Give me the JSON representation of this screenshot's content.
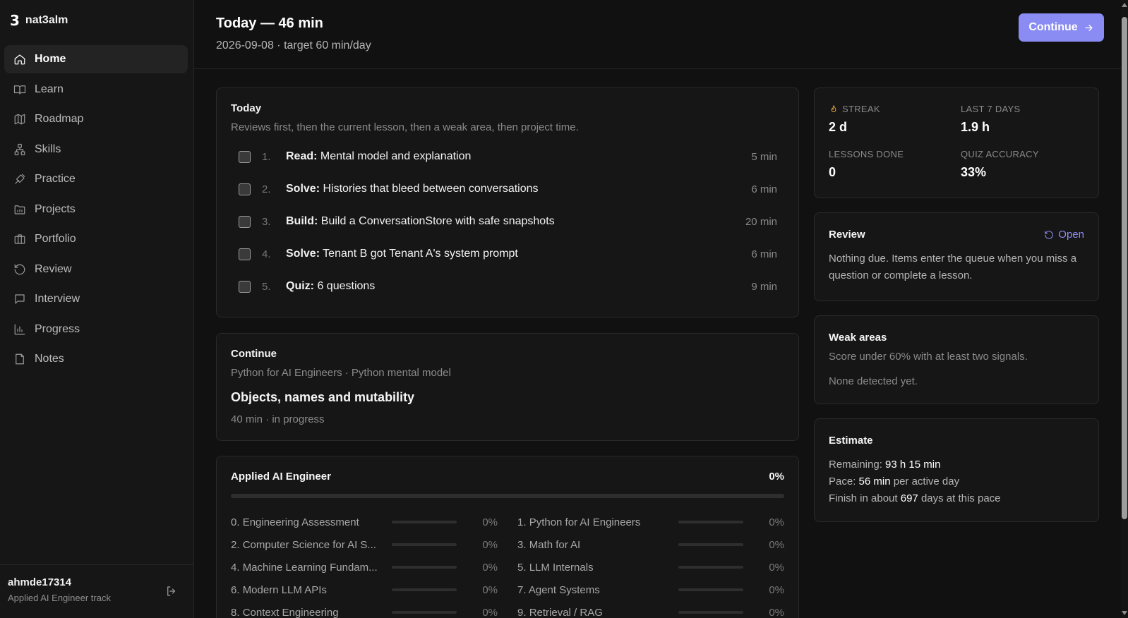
{
  "brand": {
    "name": "nat3alm",
    "logo_glyph": "3"
  },
  "sidebar": {
    "items": [
      {
        "label": "Home",
        "icon": "home-icon",
        "active": true
      },
      {
        "label": "Learn",
        "icon": "book-icon"
      },
      {
        "label": "Roadmap",
        "icon": "map-icon"
      },
      {
        "label": "Skills",
        "icon": "skills-icon"
      },
      {
        "label": "Practice",
        "icon": "practice-icon"
      },
      {
        "label": "Projects",
        "icon": "projects-icon"
      },
      {
        "label": "Portfolio",
        "icon": "portfolio-icon"
      },
      {
        "label": "Review",
        "icon": "review-icon"
      },
      {
        "label": "Interview",
        "icon": "interview-icon"
      },
      {
        "label": "Progress",
        "icon": "progress-icon"
      },
      {
        "label": "Notes",
        "icon": "notes-icon"
      }
    ],
    "user": {
      "name": "ahmde17314",
      "track": "Applied AI Engineer track"
    }
  },
  "header": {
    "title": "Today — 46 min",
    "subtitle": "2026-09-08 · target 60 min/day",
    "continue_label": "Continue"
  },
  "today": {
    "title": "Today",
    "description": "Reviews first, then the current lesson, then a weak area, then project time.",
    "tasks": [
      {
        "num": "1.",
        "kind": "Read:",
        "text": "Mental model and explanation",
        "minutes": "5 min"
      },
      {
        "num": "2.",
        "kind": "Solve:",
        "text": "Histories that bleed between conversations",
        "minutes": "6 min"
      },
      {
        "num": "3.",
        "kind": "Build:",
        "text": "Build a ConversationStore with safe snapshots",
        "minutes": "20 min"
      },
      {
        "num": "4.",
        "kind": "Solve:",
        "text": "Tenant B got Tenant A's system prompt",
        "minutes": "6 min"
      },
      {
        "num": "5.",
        "kind": "Quiz:",
        "text": "6 questions",
        "minutes": "9 min"
      }
    ]
  },
  "continue_card": {
    "title": "Continue",
    "breadcrumb": "Python for AI Engineers · Python mental model",
    "lesson": "Objects, names and mutability",
    "meta": "40 min · in progress"
  },
  "track": {
    "title": "Applied AI Engineer",
    "percent": "0%",
    "progress": 0,
    "modules": [
      {
        "num": "0.",
        "name": "Engineering Assessment",
        "percent": "0%",
        "progress": 0
      },
      {
        "num": "1.",
        "name": "Python for AI Engineers",
        "percent": "0%",
        "progress": 0
      },
      {
        "num": "2.",
        "name": "Computer Science for AI S...",
        "percent": "0%",
        "progress": 0
      },
      {
        "num": "3.",
        "name": "Math for AI",
        "percent": "0%",
        "progress": 0
      },
      {
        "num": "4.",
        "name": "Machine Learning Fundam...",
        "percent": "0%",
        "progress": 0
      },
      {
        "num": "5.",
        "name": "LLM Internals",
        "percent": "0%",
        "progress": 0
      },
      {
        "num": "6.",
        "name": "Modern LLM APIs",
        "percent": "0%",
        "progress": 0
      },
      {
        "num": "7.",
        "name": "Agent Systems",
        "percent": "0%",
        "progress": 0
      },
      {
        "num": "8.",
        "name": "Context Engineering",
        "percent": "0%",
        "progress": 0
      },
      {
        "num": "9.",
        "name": "Retrieval / RAG",
        "percent": "0%",
        "progress": 0
      }
    ]
  },
  "stats": {
    "streak_label": "STREAK",
    "streak_value": "2 d",
    "last7_label": "LAST 7 DAYS",
    "last7_value": "1.9 h",
    "lessons_label": "LESSONS DONE",
    "lessons_value": "0",
    "quiz_label": "QUIZ ACCURACY",
    "quiz_value": "33%"
  },
  "review": {
    "title": "Review",
    "open_label": "Open",
    "text": "Nothing due. Items enter the queue when you miss a question or complete a lesson."
  },
  "weak": {
    "title": "Weak areas",
    "description": "Score under 60% with at least two signals.",
    "none": "None detected yet."
  },
  "estimate": {
    "title": "Estimate",
    "remaining_label": "Remaining:",
    "remaining_value": "93 h 15 min",
    "pace_label": "Pace:",
    "pace_value": "56 min",
    "pace_suffix": "per active day",
    "finish_prefix": "Finish in about",
    "finish_value": "697",
    "finish_suffix": "days at this pace"
  },
  "colors": {
    "accent": "#8a8cf3",
    "background": "#111111",
    "card": "#161616",
    "streak_icon": "#e0a23a"
  }
}
